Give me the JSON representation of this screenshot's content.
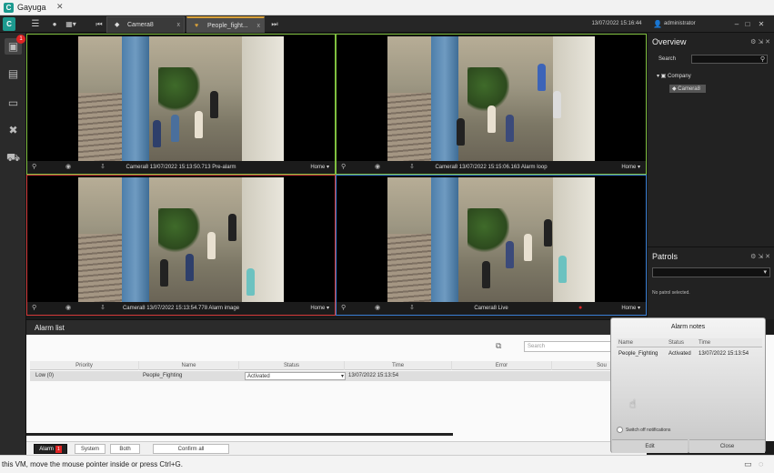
{
  "vm_window": {
    "app_logo": "C",
    "title": "Gayuga",
    "close": "✕"
  },
  "toolbar": {
    "tabs": [
      {
        "label": "Camera8",
        "close": "x"
      },
      {
        "label": "People_fight...",
        "close": "x"
      }
    ],
    "datetime": "13/07/2022 15:16:44",
    "user": "administrator",
    "window_controls": [
      "–",
      "□",
      "✕"
    ]
  },
  "sidebar": {
    "notification_count": "1"
  },
  "tiles": [
    {
      "label": "Camera8 13/07/2022 15:13:50.713 Pre-alarm",
      "home": "Home ▾",
      "border": "#7fbf3f"
    },
    {
      "label": "Camera8 13/07/2022 15:15:06.163 Alarm loop",
      "home": "Home ▾",
      "border": "#7fbf3f"
    },
    {
      "label": "Camera8 13/07/2022 15:13:54.778 Alarm image",
      "home": "Home ▾",
      "border": "#d43a3a"
    },
    {
      "label": "Camera8 Live",
      "home": "Home ▾",
      "border": "#3a7fd4"
    }
  ],
  "overview": {
    "title": "Overview",
    "search_label": "Search",
    "tree": {
      "company": "Company",
      "camera": "Camera8"
    }
  },
  "patrols": {
    "title": "Patrols",
    "empty": "No patrol selected."
  },
  "alarm_list": {
    "title": "Alarm list",
    "search_placeholder": "Search",
    "columns": [
      "Priority",
      "Name",
      "Status",
      "Time",
      "Error",
      "Sou"
    ],
    "rows": [
      {
        "priority": "Low (0)",
        "name": "People_Fighting",
        "status": "Activated",
        "time": "13/07/2022 15:13:54"
      }
    ],
    "footer": {
      "alarm": "Alarm",
      "alarm_count": "1",
      "system": "System",
      "both": "Both",
      "confirm_all": "Confirm all"
    }
  },
  "popup": {
    "title": "Alarm notes",
    "headers": [
      "Name",
      "Status",
      "Time"
    ],
    "row": [
      "People_Fighting",
      "Activated",
      "13/07/2022 15:13:54"
    ],
    "switch_label": "Switch off notifications",
    "buttons": [
      "Edit",
      "Close"
    ]
  },
  "statusbar": {
    "message": "this VM, move the mouse pointer inside or press Ctrl+G."
  },
  "colors": {
    "accent": "#1d9a8f",
    "tab_highlight": "#d9a13a",
    "alarm_red": "#e02424"
  }
}
